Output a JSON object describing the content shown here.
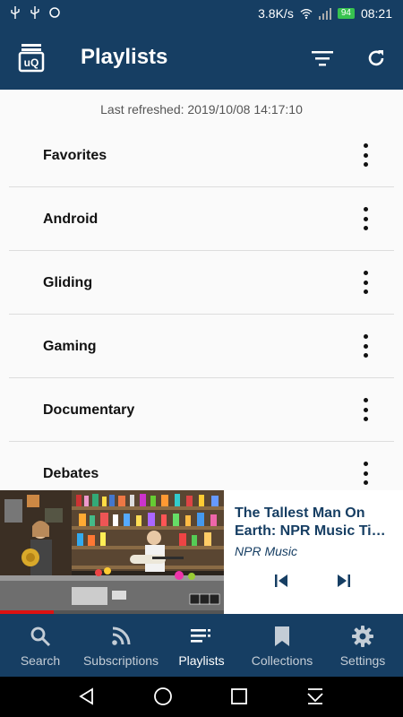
{
  "status_bar": {
    "speed": "3.8K/s",
    "battery": "94",
    "time": "08:21",
    "left_icons": [
      "usb-icon",
      "usb-icon",
      "sync-icon"
    ],
    "right_icons": [
      "wifi-icon",
      "signal-icon",
      "battery-icon"
    ]
  },
  "app_bar": {
    "title": "Playlists",
    "logo_text": "uQ",
    "actions": [
      "filter-icon",
      "refresh-icon"
    ]
  },
  "main": {
    "last_refreshed": "Last refreshed: 2019/10/08 14:17:10",
    "playlists": [
      {
        "label": "Favorites"
      },
      {
        "label": "Android"
      },
      {
        "label": "Gliding"
      },
      {
        "label": "Gaming"
      },
      {
        "label": "Documentary"
      },
      {
        "label": "Debates"
      }
    ]
  },
  "player": {
    "title_line1": "The Tallest Man On",
    "title_line2": "Earth: NPR Music Tiny Desk Concert",
    "channel": "NPR Music",
    "progress": 0.24,
    "watermark": "npr",
    "controls": [
      "previous-icon",
      "next-icon"
    ]
  },
  "bottom_nav": {
    "items": [
      {
        "label": "Search",
        "icon": "search-icon",
        "active": false
      },
      {
        "label": "Subscriptions",
        "icon": "rss-icon",
        "active": false
      },
      {
        "label": "Playlists",
        "icon": "playlist-icon",
        "active": true
      },
      {
        "label": "Collections",
        "icon": "bookmark-icon",
        "active": false
      },
      {
        "label": "Settings",
        "icon": "gear-icon",
        "active": false
      }
    ]
  },
  "system_nav": [
    "back-icon",
    "home-icon",
    "recents-icon",
    "notification-drawer-icon"
  ],
  "colors": {
    "primary": "#163e63",
    "background": "#fafafa",
    "progress": "#d11111",
    "battery": "#37c24f"
  }
}
